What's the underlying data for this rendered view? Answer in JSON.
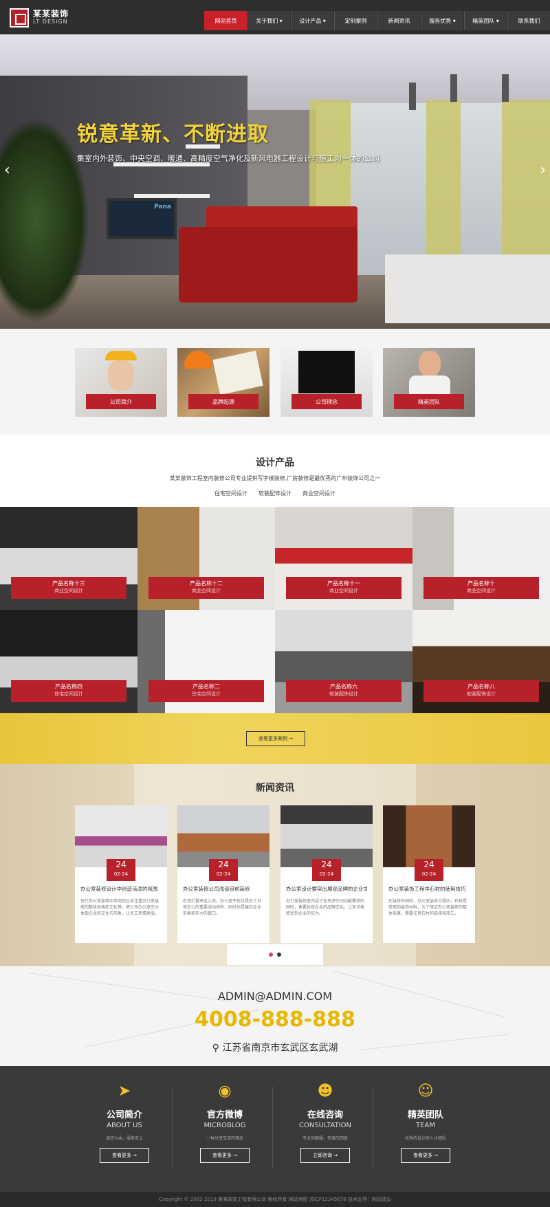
{
  "header": {
    "logo_cn": "某某装饰",
    "logo_en": "LT DESIGN",
    "nav": [
      {
        "label": "网站首页",
        "active": true
      },
      {
        "label": "关于我们 ▾"
      },
      {
        "label": "设计产品 ▾"
      },
      {
        "label": "定制案例"
      },
      {
        "label": "新闻资讯"
      },
      {
        "label": "服务优势 ▾"
      },
      {
        "label": "精英团队 ▾"
      },
      {
        "label": "联系我们"
      }
    ]
  },
  "hero": {
    "title": "锐意革新、不断进取",
    "subtitle": "集室内外装饰、中央空调、暖通、高精度空气净化及新风电器工程设计与施工为一体的公司",
    "tv_text": "Pana",
    "prev_arrow": "‹",
    "next_arrow": "›"
  },
  "features": [
    {
      "label": "公司简介"
    },
    {
      "label": "品牌起源"
    },
    {
      "label": "公司理念"
    },
    {
      "label": "精英团队"
    }
  ],
  "products": {
    "title": "设计产品",
    "desc": "某某装饰工程室内装修公司专业提供写字楼装修,厂房装修是最优秀的广州装饰公司之一",
    "tabs": [
      "住宅空间设计",
      "软装配饰设计",
      "商业空间设计"
    ],
    "items": [
      {
        "name": "产品名称十三",
        "cat": "商业空间设计"
      },
      {
        "name": "产品名称十二",
        "cat": "商业空间设计"
      },
      {
        "name": "产品名称十一",
        "cat": "商业空间设计"
      },
      {
        "name": "产品名称十",
        "cat": "商业空间设计"
      },
      {
        "name": "产品名称四",
        "cat": "住宅空间设计"
      },
      {
        "name": "产品名称二",
        "cat": "住宅空间设计"
      },
      {
        "name": "产品名称六",
        "cat": "软装配饰设计"
      },
      {
        "name": "产品名称八",
        "cat": "软装配饰设计"
      }
    ],
    "more_label": "查看更多案例 →"
  },
  "news": {
    "title": "新闻资讯",
    "items": [
      {
        "day": "24",
        "md": "02-24",
        "title": "办公室装修设计中创造活泼的氛围",
        "body": "现代办公室装修中采用的企业注重办公室装修的整体风格和文化等，使公司办公室充分体现企业的文化与形象，让员工热情高涨。"
      },
      {
        "day": "24",
        "md": "02-24",
        "title": "办公室装修公司浅谈目前装修",
        "body": "在我们看来这么说，办公室不仅仅是员工日常办公的重要活动场所，同时也是展示企业形象和实力的窗口。"
      },
      {
        "day": "24",
        "md": "02-24",
        "title": "办公室设计要突出展现品牌的企业文化",
        "body": "办公室装修室内设计在考虑空间功能需求的同时，更要体现企业的品牌文化，让来访者感受到企业的实力。"
      },
      {
        "day": "24",
        "md": "02-24",
        "title": "办公室装饰工程中石材的使用技巧",
        "body": "在装修的同时，办公室装修工程中，石材是常用的装饰材料，为了保证办公室装修的整体效果，需要注意石材的选择和施工。"
      }
    ]
  },
  "contact": {
    "email": "ADMIN@ADMIN.COM",
    "phone": "4008-888-888",
    "address": "江苏省南京市玄武区玄武湖",
    "address_icon": "location-pin"
  },
  "footer": [
    {
      "icon": "paper-plane",
      "cn": "公司简介",
      "en": "ABOUT US",
      "desc": "诚信为本，服务至上",
      "btn": "查看更多 →"
    },
    {
      "icon": "weibo",
      "cn": "官方微博",
      "en": "MICROBLOG",
      "desc": "一种分享交流的理念",
      "btn": "查看更多 →"
    },
    {
      "icon": "headset",
      "cn": "在线咨询",
      "en": "CONSULTATION",
      "desc": "专业的客服，快速的回复",
      "btn": "立即咨询 →"
    },
    {
      "icon": "team",
      "cn": "精英团队",
      "en": "TEAM",
      "desc": "优秀的设计师人才团队",
      "btn": "查看更多 →"
    }
  ],
  "copyright": "Copyright © 2002-2019 某某装饰工程有限公司 版权所有   网站地图   苏ICP12345678   技术支持：网站建设",
  "colors": {
    "accent": "#b8202a",
    "yellow": "#f2c029",
    "dark": "#3a3a3a"
  }
}
